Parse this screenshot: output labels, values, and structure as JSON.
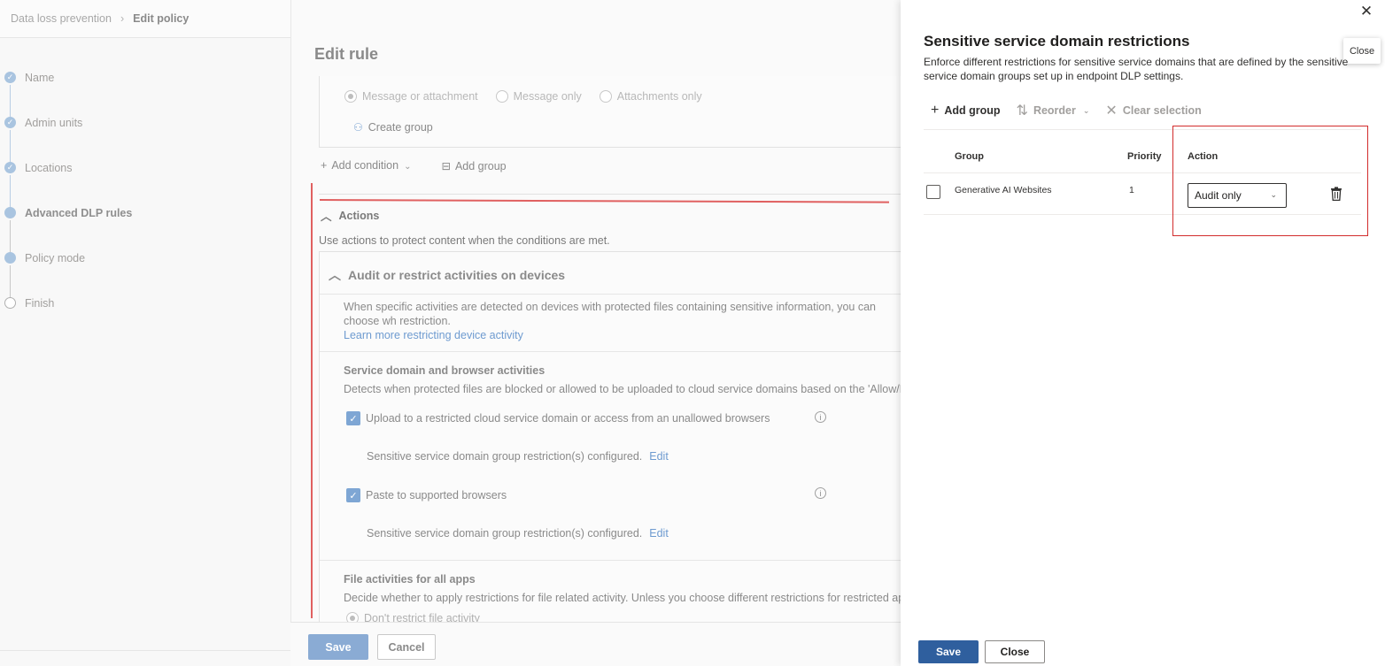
{
  "breadcrumb": {
    "parent": "Data loss prevention",
    "current": "Edit policy"
  },
  "steps": [
    {
      "label": "Name"
    },
    {
      "label": "Admin units"
    },
    {
      "label": "Locations"
    },
    {
      "label": "Advanced DLP rules"
    },
    {
      "label": "Policy mode"
    },
    {
      "label": "Finish"
    }
  ],
  "rule": {
    "title": "Edit rule",
    "radios": [
      "Message or attachment",
      "Message only",
      "Attachments only"
    ],
    "create_group": "Create group",
    "add_condition": "Add condition",
    "add_group": "Add group",
    "actions_heading": "Actions",
    "actions_desc": "Use actions to protect content when the conditions are met.",
    "audit_heading": "Audit or restrict activities on devices",
    "audit_text": "When specific activities are detected on devices with protected files containing sensitive information, you can choose wh restriction.",
    "audit_link": "Learn more restricting device activity",
    "svc_title": "Service domain and browser activities",
    "svc_desc": "Detects when protected files are blocked or allowed to be uploaded to cloud service domains based on the 'Allow/Block",
    "cb1": "Upload to a restricted cloud service domain or access from an unallowed browsers",
    "cfg1": "Sensitive service domain group restriction(s) configured.",
    "cb2": "Paste to supported browsers",
    "cfg2": "Sensitive service domain group restriction(s) configured.",
    "edit_link": "Edit",
    "fa_title": "File activities for all apps",
    "fa_desc": "Decide whether to apply restrictions for file related activity. Unless you choose different restrictions for restricted apps or",
    "fa_radio": "Don't restrict file activity",
    "save": "Save",
    "cancel": "Cancel"
  },
  "flyout": {
    "title": "Sensitive service domain restrictions",
    "desc": "Enforce different restrictions for sensitive service domains that are defined by the sensitive service domain groups set up in endpoint DLP settings.",
    "close_tooltip": "Close",
    "commands": {
      "add_group": "Add group",
      "reorder": "Reorder",
      "clear_selection": "Clear selection"
    },
    "table": {
      "headers": {
        "group": "Group",
        "priority": "Priority",
        "action": "Action"
      },
      "rows": [
        {
          "group": "Generative AI Websites",
          "priority": "1",
          "action": "Audit only"
        }
      ]
    },
    "save": "Save",
    "close": "Close"
  },
  "colors": {
    "annotation_red": "#d22c2c",
    "primary": "#2f5f9e"
  },
  "icons": [
    "check-icon",
    "chevron-right-icon",
    "close-icon",
    "add-icon",
    "reorder-icon",
    "clear-icon",
    "trash-icon",
    "info-icon",
    "chevron-up-icon",
    "chevron-down-icon",
    "group-icon"
  ]
}
